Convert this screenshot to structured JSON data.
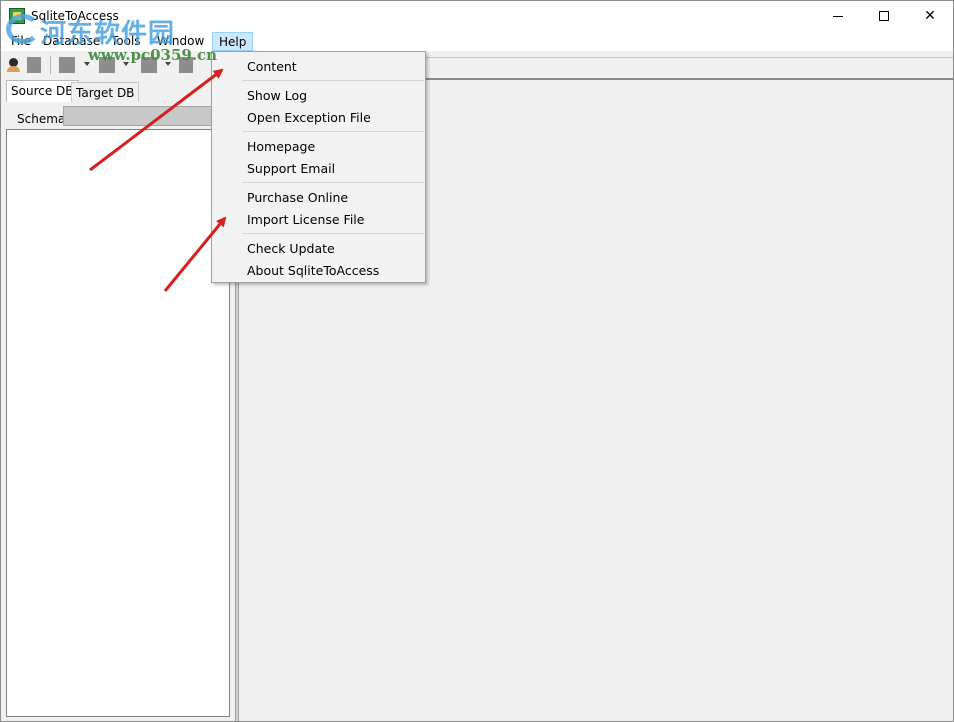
{
  "window": {
    "title": "SqliteToAccess",
    "minimize_glyph": "",
    "close_glyph": "✕"
  },
  "watermark": {
    "chinese_text": "河东软件园",
    "url": "www.pc0359.cn"
  },
  "menubar": {
    "items": [
      {
        "label": "File"
      },
      {
        "label": "Database"
      },
      {
        "label": "Tools"
      },
      {
        "label": "Window"
      },
      {
        "label": "Help"
      }
    ],
    "active": "Help"
  },
  "left_panel": {
    "tabs": [
      {
        "label": "Source DB",
        "active": true
      },
      {
        "label": "Target DB",
        "active": false
      }
    ],
    "schema_label": "Schema",
    "schema_value": ""
  },
  "help_menu": {
    "groups": [
      [
        "Content"
      ],
      [
        "Show Log",
        "Open Exception File"
      ],
      [
        "Homepage",
        "Support Email"
      ],
      [
        "Purchase Online",
        "Import License File"
      ],
      [
        "Check Update",
        "About SqliteToAccess"
      ]
    ],
    "items": {
      "content": "Content",
      "show_log": "Show Log",
      "open_exception_file": "Open Exception File",
      "homepage": "Homepage",
      "support_email": "Support Email",
      "purchase_online": "Purchase Online",
      "import_license_file": "Import License File",
      "check_update": "Check Update",
      "about": "About SqliteToAccess"
    }
  },
  "colors": {
    "menu_highlight": "#cce8ff",
    "arrow": "#d42020",
    "watermark_blue": "#4aa3e0",
    "watermark_green": "#3a8a3a"
  },
  "icons": {
    "toolbar": [
      "user-icon",
      "toolbar-button-icon",
      "dropdown-caret-icon"
    ]
  }
}
